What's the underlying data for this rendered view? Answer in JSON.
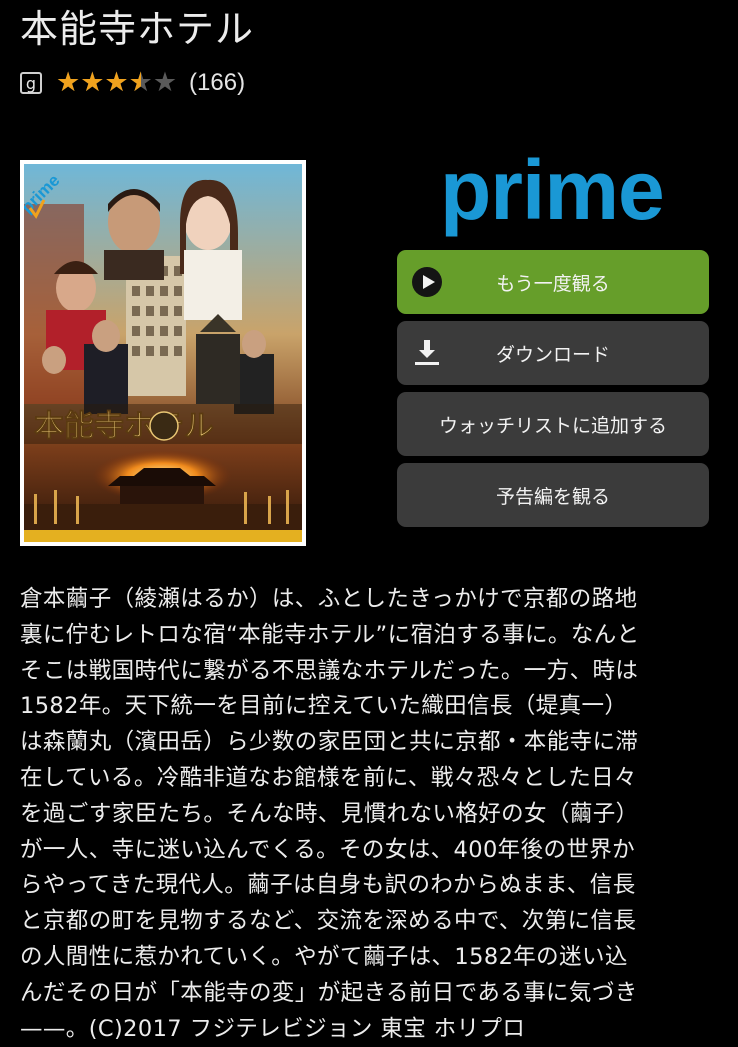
{
  "title": "本能寺ホテル",
  "rating": {
    "badge": "g",
    "stars": 3.5,
    "stars_glyphs": "★★★★★",
    "review_count": "(166)",
    "star_color": "#f0a21d"
  },
  "poster": {
    "badge": "prime",
    "title_text": "本能寺ホテル"
  },
  "prime_logo": "prime",
  "buttons": {
    "play": "もう一度観る",
    "download": "ダウンロード",
    "watchlist": "ウォッチリストに追加する",
    "trailer": "予告編を観る"
  },
  "colors": {
    "play_button": "#669e2a",
    "secondary_button": "#3b3b3b",
    "prime_blue": "#1a98d5"
  },
  "description_lines": [
    "倉本繭子（綾瀬はるか）は、ふとしたきっかけで京都の路地",
    "裏に佇むレトロな宿“本能寺ホテル”に宿泊する事に。なんと",
    "そこは戦国時代に繋がる不思議なホテルだった。一方、時は",
    "1582年。天下統一を目前に控えていた織田信長（堤真一）",
    "は森蘭丸（濱田岳）ら少数の家臣団と共に京都・本能寺に滞",
    "在している。冷酷非道なお館様を前に、戦々恐々とした日々",
    "を過ごす家臣たち。そんな時、見慣れない格好の女（繭子）",
    "が一人、寺に迷い込んでくる。その女は、400年後の世界か",
    "らやってきた現代人。繭子は自身も訳のわからぬまま、信長",
    "と京都の町を見物するなど、交流を深める中で、次第に信長",
    "の人間性に惹かれていく。やがて繭子は、1582年の迷い込",
    "んだその日が「本能寺の変」が起きる前日である事に気づき",
    "——。(C)2017 フジテレビジョン 東宝 ホリプロ"
  ]
}
